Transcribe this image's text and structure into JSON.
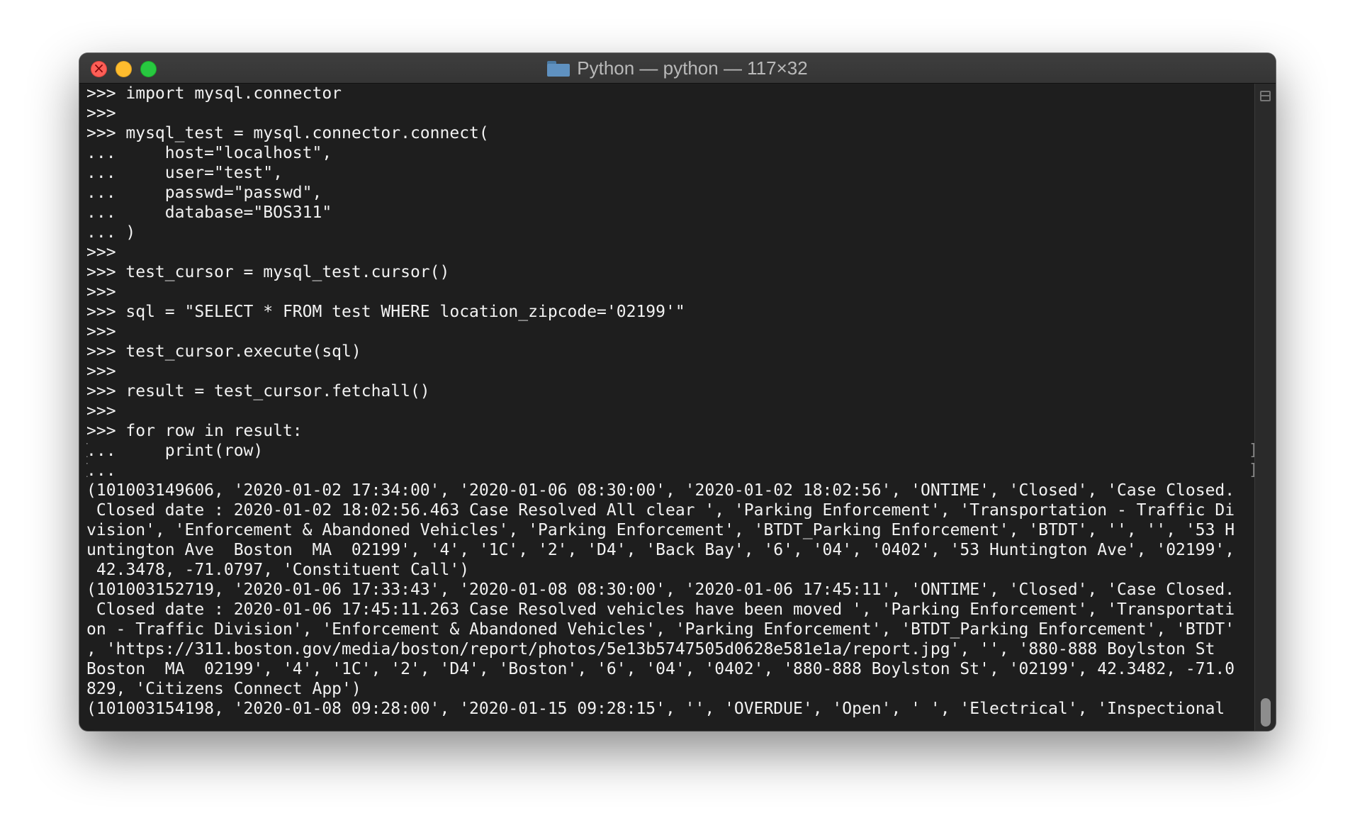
{
  "window": {
    "title": "Python — python — 117×32"
  },
  "terminal": {
    "lines": [
      ">>> import mysql.connector",
      ">>>",
      ">>> mysql_test = mysql.connector.connect(",
      "...     host=\"localhost\",",
      "...     user=\"test\",",
      "...     passwd=\"passwd\",",
      "...     database=\"BOS311\"",
      "... )",
      ">>>",
      ">>> test_cursor = mysql_test.cursor()",
      ">>>",
      ">>> sql = \"SELECT * FROM test WHERE location_zipcode='02199'\"",
      ">>>",
      ">>> test_cursor.execute(sql)",
      ">>>",
      ">>> result = test_cursor.fetchall()",
      ">>>",
      ">>> for row in result:",
      "...     print(row)",
      "...",
      "(101003149606, '2020-01-02 17:34:00', '2020-01-06 08:30:00', '2020-01-02 18:02:56', 'ONTIME', 'Closed', 'Case Closed.",
      " Closed date : 2020-01-02 18:02:56.463 Case Resolved All clear ', 'Parking Enforcement', 'Transportation - Traffic Di",
      "vision', 'Enforcement & Abandoned Vehicles', 'Parking Enforcement', 'BTDT_Parking Enforcement', 'BTDT', '', '', '53 H",
      "untington Ave  Boston  MA  02199', '4', '1C', '2', 'D4', 'Back Bay', '6', '04', '0402', '53 Huntington Ave', '02199',",
      " 42.3478, -71.0797, 'Constituent Call')",
      "(101003152719, '2020-01-06 17:33:43', '2020-01-08 08:30:00', '2020-01-06 17:45:11', 'ONTIME', 'Closed', 'Case Closed.",
      " Closed date : 2020-01-06 17:45:11.263 Case Resolved vehicles have been moved ', 'Parking Enforcement', 'Transportati",
      "on - Traffic Division', 'Enforcement & Abandoned Vehicles', 'Parking Enforcement', 'BTDT_Parking Enforcement', 'BTDT'",
      ", 'https://311.boston.gov/media/boston/report/photos/5e13b5747505d0628e581e1a/report.jpg', '', '880-888 Boylston St",
      "Boston  MA  02199', '4', '1C', '2', 'D4', 'Boston', '6', '04', '0402', '880-888 Boylston St', '02199', 42.3482, -71.0",
      "829, 'Citizens Connect App')",
      "(101003154198, '2020-01-08 09:28:00', '2020-01-15 09:28:15', '', 'OVERDUE', 'Open', ' ', 'Electrical', 'Inspectional"
    ]
  }
}
